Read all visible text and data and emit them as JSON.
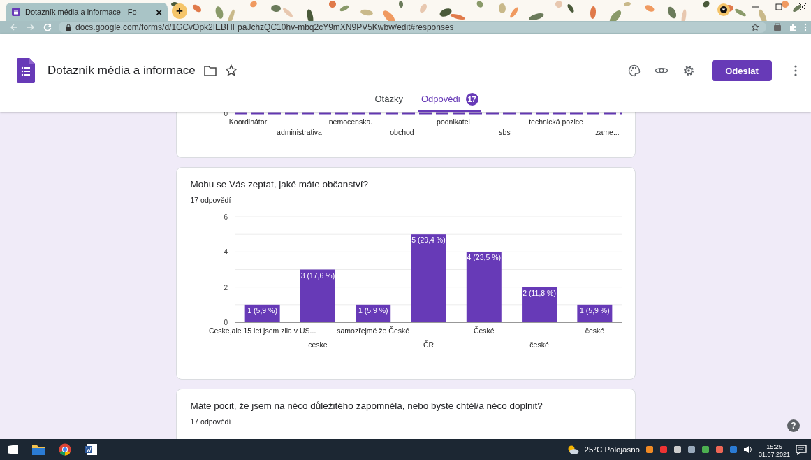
{
  "browser": {
    "tab": {
      "title": "Dotazník média a informace - Fo",
      "close": "×"
    },
    "new_tab": "+",
    "url": "docs.google.com/forms/d/1GCvOpk2IEBHFpaJchzQC10hv-mbq2cY9mXN9PV5Kwbw/edit#responses"
  },
  "form_header": {
    "title": "Dotazník média a informace",
    "send_button": "Odeslat",
    "tabs": [
      {
        "label": "Otázky",
        "selected": false
      },
      {
        "label": "Odpovědi",
        "badge": "17",
        "selected": true
      }
    ]
  },
  "cards": [
    {
      "kind": "cut_chart",
      "axis_label": "0",
      "labels": [
        "Koordinátor",
        "administrativa",
        "nemocenska.",
        "obchod",
        "podnikatel",
        "sbs",
        "technická pozice",
        "zame..."
      ]
    },
    {
      "kind": "chart",
      "question": "Mohu se Vás zeptat, jaké máte občanství?",
      "count": "17 odpovědí",
      "chart_data": {
        "type": "bar",
        "categories": [
          "Ceske,ale 15 let jsem zila v US...",
          "ceske",
          "samozřejmě že České",
          "ČR",
          "České",
          "české",
          "české"
        ],
        "values": [
          1,
          3,
          1,
          5,
          4,
          2,
          1
        ],
        "ylim": [
          0,
          6
        ],
        "yticks": [
          0,
          2,
          4,
          6
        ],
        "value_labels": [
          "1 (5,9 %)",
          "3 (17,6 %)",
          "1 (5,9 %)",
          "5 (29,4 %)",
          "4 (23,5 %)",
          "2 (11,8 %)",
          "1 (5,9 %)"
        ]
      }
    },
    {
      "kind": "text",
      "question": "Máte pocit, že jsem na něco důležitého zapomněla, nebo byste chtěl/a něco doplnit?",
      "count": "17 odpovědí"
    }
  ],
  "help": "?",
  "taskbar": {
    "weather": "25°C Polojasno",
    "time": "15:25",
    "date": "31.07.2021"
  }
}
